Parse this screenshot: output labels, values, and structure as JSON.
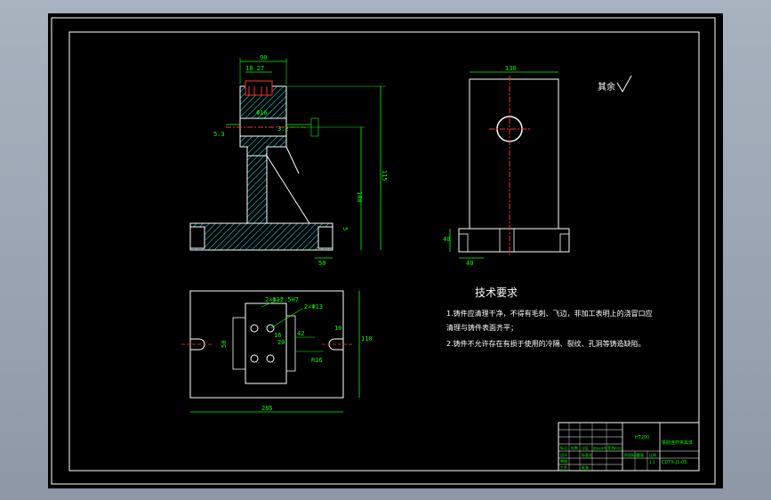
{
  "drawing": {
    "roughness_label": "其余",
    "tech_title": "技术要求",
    "tech_lines": [
      "1.铸件应清理干净，不得有毛刺、飞边，非加工表明上的浇冒口应",
      "清理与铸件表面齐平；",
      "2.铸件不允许存在有损于使用的冷隔、裂纹、孔洞等铸造缺陷。"
    ],
    "front_dims": {
      "width_90": "90",
      "slot": "18  27",
      "bore_dia": "Φ16",
      "height_total": "115",
      "height_mid": "100",
      "base_50": "50",
      "step_5": "5",
      "left_5_3": "5.3",
      "right_3_2": "3.2"
    },
    "side_dims": {
      "width_130": "130",
      "base_h": "40",
      "base_w": "40"
    },
    "top_dims": {
      "holes_a": "2×Φ12.5H7",
      "holes_b": "2×Φ13",
      "length_285": "285",
      "height_110": "110",
      "w_16": "16",
      "w_20": "20",
      "r_16": "R16",
      "d_10": "10",
      "left_50": "50",
      "mid_42": "42"
    },
    "title_block": {
      "part_name": "铣削连杆夹具体",
      "material": "HT200",
      "drawing_no": "CDTX-J1-05",
      "row_labels": [
        "标记",
        "处数",
        "分区",
        "更改文件号",
        "签名",
        "年月日"
      ],
      "sub_labels": [
        "设计",
        "标准化",
        "审核",
        "工艺",
        "批准"
      ],
      "stage": "阶段标记",
      "weight": "重量",
      "scale": "比例",
      "scale_val": "1:1"
    }
  }
}
